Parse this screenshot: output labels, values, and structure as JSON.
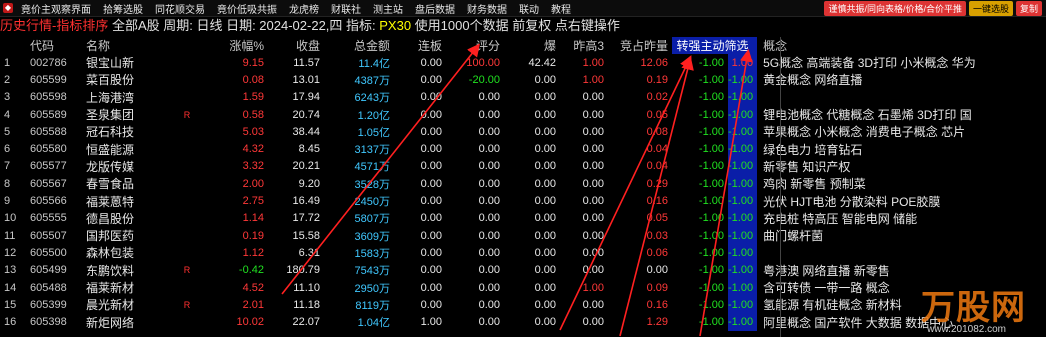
{
  "menubar": {
    "items": [
      "竟价主观察界面",
      "拾筹选股",
      "同花顺交易",
      "竟价低吸共振",
      "龙虎榜",
      "财联社",
      "测主站",
      "盘后数据",
      "财务数据",
      "联动",
      "教程"
    ],
    "right_buttons": [
      "谨慎共振/同向表格/价格/合价平推",
      "一键选股",
      "复制"
    ]
  },
  "status": {
    "prefix": "历史行情-指标排序",
    "text": " 全部A股 周期: 日线 日期: 2024-02-22,四 指标: ",
    "indicator": "PX30",
    "suffix": " 使用1000个数据 前复权 点右键操作"
  },
  "table": {
    "headers": [
      "",
      "代码",
      "名称",
      "",
      "涨幅%",
      "收盘",
      "总金额",
      "连板",
      "评分",
      "爆",
      "昨高3",
      "竞占昨量",
      "转强主动筛选",
      "概念"
    ],
    "rows": [
      {
        "idx": "1",
        "code": "002786",
        "name": "银宝山新",
        "flag": "",
        "chg": "9.15",
        "close": "11.57",
        "amt": "11.4亿",
        "board": "0.00",
        "score": "100.00",
        "boom": "42.42",
        "high3": "1.00",
        "ratio": "12.06",
        "turn": "-1.00",
        "sel": "1.00",
        "concept": "5G概念 高端装备 3D打印 小米概念 华为"
      },
      {
        "idx": "2",
        "code": "605599",
        "name": "菜百股份",
        "flag": "",
        "chg": "0.08",
        "close": "13.01",
        "amt": "4387万",
        "board": "0.00",
        "score": "-20.00",
        "boom": "0.00",
        "high3": "1.00",
        "ratio": "0.19",
        "turn": "-1.00",
        "sel": "-1.00",
        "concept": "黄金概念 网络直播"
      },
      {
        "idx": "3",
        "code": "605598",
        "name": "上海港湾",
        "flag": "",
        "chg": "1.59",
        "close": "17.94",
        "amt": "6243万",
        "board": "0.00",
        "score": "0.00",
        "boom": "0.00",
        "high3": "0.00",
        "ratio": "0.02",
        "turn": "-1.00",
        "sel": "-1.00",
        "concept": ""
      },
      {
        "idx": "4",
        "code": "605589",
        "name": "圣泉集团",
        "flag": "R",
        "chg": "0.58",
        "close": "20.74",
        "amt": "1.20亿",
        "board": "0.00",
        "score": "0.00",
        "boom": "0.00",
        "high3": "0.00",
        "ratio": "0.05",
        "turn": "-1.00",
        "sel": "-1.00",
        "concept": "锂电池概念 代糖概念 石墨烯 3D打印 国"
      },
      {
        "idx": "5",
        "code": "605588",
        "name": "冠石科技",
        "flag": "",
        "chg": "5.03",
        "close": "38.44",
        "amt": "1.05亿",
        "board": "0.00",
        "score": "0.00",
        "boom": "0.00",
        "high3": "0.00",
        "ratio": "0.08",
        "turn": "-1.00",
        "sel": "-1.00",
        "concept": "苹果概念 小米概念 消费电子概念 芯片"
      },
      {
        "idx": "6",
        "code": "605580",
        "name": "恒盛能源",
        "flag": "",
        "chg": "4.32",
        "close": "8.45",
        "amt": "3137万",
        "board": "0.00",
        "score": "0.00",
        "boom": "0.00",
        "high3": "0.00",
        "ratio": "0.04",
        "turn": "-1.00",
        "sel": "-1.00",
        "concept": "绿色电力 培育钻石"
      },
      {
        "idx": "7",
        "code": "605577",
        "name": "龙版传媒",
        "flag": "",
        "chg": "3.32",
        "close": "20.21",
        "amt": "4571万",
        "board": "0.00",
        "score": "0.00",
        "boom": "0.00",
        "high3": "0.00",
        "ratio": "0.04",
        "turn": "-1.00",
        "sel": "-1.00",
        "concept": "新零售 知识产权"
      },
      {
        "idx": "8",
        "code": "605567",
        "name": "春雪食品",
        "flag": "",
        "chg": "2.00",
        "close": "9.20",
        "amt": "3528万",
        "board": "0.00",
        "score": "0.00",
        "boom": "0.00",
        "high3": "0.00",
        "ratio": "0.29",
        "turn": "-1.00",
        "sel": "-1.00",
        "concept": "鸡肉 新零售 预制菜"
      },
      {
        "idx": "9",
        "code": "605566",
        "name": "福莱蒽特",
        "flag": "",
        "chg": "2.75",
        "close": "16.49",
        "amt": "2450万",
        "board": "0.00",
        "score": "0.00",
        "boom": "0.00",
        "high3": "0.00",
        "ratio": "0.16",
        "turn": "-1.00",
        "sel": "-1.00",
        "concept": "光伏 HJT电池 分散染料 POE胶膜"
      },
      {
        "idx": "10",
        "code": "605555",
        "name": "德昌股份",
        "flag": "",
        "chg": "1.14",
        "close": "17.72",
        "amt": "5807万",
        "board": "0.00",
        "score": "0.00",
        "boom": "0.00",
        "high3": "0.00",
        "ratio": "0.05",
        "turn": "-1.00",
        "sel": "-1.00",
        "concept": "充电桩 特高压 智能电网 储能"
      },
      {
        "idx": "11",
        "code": "605507",
        "name": "国邦医药",
        "flag": "",
        "chg": "0.19",
        "close": "15.58",
        "amt": "3609万",
        "board": "0.00",
        "score": "0.00",
        "boom": "0.00",
        "high3": "0.00",
        "ratio": "0.03",
        "turn": "-1.00",
        "sel": "-1.00",
        "concept": "曲门螺杆菌"
      },
      {
        "idx": "12",
        "code": "605500",
        "name": "森林包装",
        "flag": "",
        "chg": "1.12",
        "close": "6.31",
        "amt": "1583万",
        "board": "0.00",
        "score": "0.00",
        "boom": "0.00",
        "high3": "0.00",
        "ratio": "0.06",
        "turn": "-1.00",
        "sel": "-1.00",
        "concept": ""
      },
      {
        "idx": "13",
        "code": "605499",
        "name": "东鹏饮料",
        "flag": "R",
        "chg": "-0.42",
        "close": "180.79",
        "amt": "7543万",
        "board": "0.00",
        "score": "0.00",
        "boom": "0.00",
        "high3": "0.00",
        "ratio": "0.00",
        "turn": "-1.00",
        "sel": "-1.00",
        "concept": "粤港澳 网络直播 新零售"
      },
      {
        "idx": "14",
        "code": "605488",
        "name": "福莱新材",
        "flag": "",
        "chg": "4.52",
        "close": "11.10",
        "amt": "2950万",
        "board": "0.00",
        "score": "0.00",
        "boom": "0.00",
        "high3": "1.00",
        "ratio": "0.09",
        "turn": "-1.00",
        "sel": "-1.00",
        "concept": "含可转债 一带一路 概念"
      },
      {
        "idx": "15",
        "code": "605399",
        "name": "晨光新材",
        "flag": "R",
        "chg": "2.01",
        "close": "11.18",
        "amt": "8119万",
        "board": "0.00",
        "score": "0.00",
        "boom": "0.00",
        "high3": "0.00",
        "ratio": "0.16",
        "turn": "-1.00",
        "sel": "-1.00",
        "concept": "氢能源 有机硅概念 新材料"
      },
      {
        "idx": "16",
        "code": "605398",
        "name": "新炬网络",
        "flag": "",
        "chg": "10.02",
        "close": "22.07",
        "amt": "1.04亿",
        "board": "1.00",
        "score": "0.00",
        "boom": "0.00",
        "high3": "0.00",
        "ratio": "1.29",
        "turn": "-1.00",
        "sel": "-1.00",
        "concept": "阿里概念 国产软件 大数据 数据中心"
      }
    ]
  },
  "watermark": {
    "brand": "万股网",
    "url": "www.201082.com"
  }
}
